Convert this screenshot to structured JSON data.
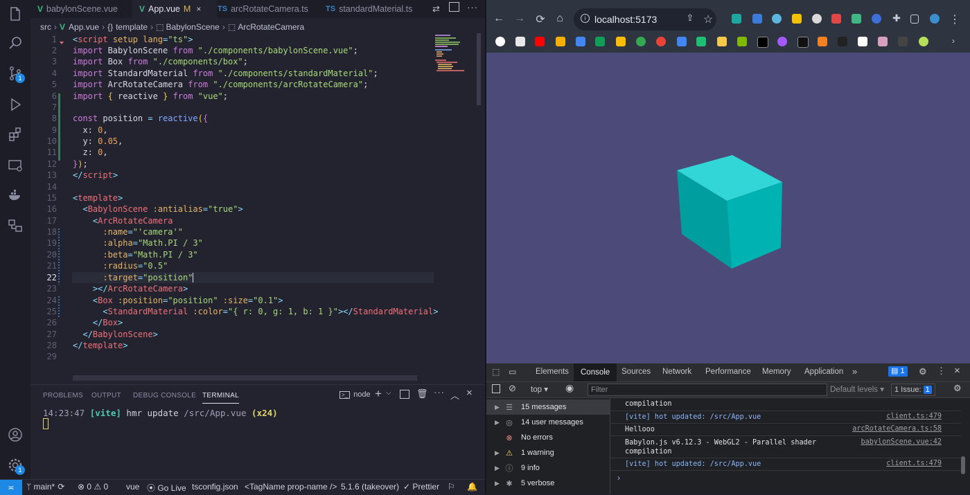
{
  "vscode": {
    "tabs": [
      {
        "label": "babylonScene.vue",
        "kind": "vue",
        "active": false
      },
      {
        "label": "App.vue",
        "kind": "vue",
        "active": true,
        "modified": "M",
        "close": "×"
      },
      {
        "label": "arcRotateCamera.ts",
        "kind": "ts",
        "active": false
      },
      {
        "label": "standardMaterial.ts",
        "kind": "ts",
        "active": false
      }
    ],
    "breadcrumb": {
      "folder": "src",
      "file": "App.vue",
      "section": "template",
      "node1": "BabylonScene",
      "node2": "ArcRotateCamera"
    },
    "activity_badges": {
      "scm": "1",
      "accounts": "1"
    },
    "line_numbers": [
      "1",
      "2",
      "3",
      "4",
      "5",
      "6",
      "7",
      "8",
      "9",
      "10",
      "11",
      "12",
      "13",
      "14",
      "15",
      "16",
      "17",
      "18",
      "19",
      "20",
      "21",
      "22",
      "23",
      "24",
      "25",
      "26",
      "27",
      "28",
      "29"
    ],
    "code": {
      "l1": {
        "open": "<",
        "tag": "script",
        "attr1": " setup",
        "attr2": " lang",
        "eq": "=",
        "val": "\"ts\"",
        "close": ">"
      },
      "l2": {
        "kw": "import",
        "name": " BabylonScene ",
        "from": "from",
        "path": " \"./components/babylonScene.vue\"",
        "end": ";"
      },
      "l3": {
        "kw": "import",
        "name": " Box ",
        "from": "from",
        "path": " \"./components/box\"",
        "end": ";"
      },
      "l4": {
        "kw": "import",
        "name": " StandardMaterial ",
        "from": "from",
        "path": " \"./components/standardMaterial\"",
        "end": ";"
      },
      "l5": {
        "kw": "import",
        "name": " ArcRotateCamera ",
        "from": "from",
        "path": " \"./components/arcRotateCamera\"",
        "end": ";"
      },
      "l6": {
        "kw": "import",
        "ob": " {",
        "name": " reactive ",
        "cb": "}",
        "from": " from",
        "path": " \"vue\"",
        "end": ";"
      },
      "l8": {
        "kw": "const",
        "name": " position ",
        "eq": "=",
        "fn": " reactive",
        "p": "(",
        "b": "{"
      },
      "l9": {
        "key": "  x:",
        "val": " 0",
        "end": ","
      },
      "l10": {
        "key": "  y:",
        "val": " 0.05",
        "end": ","
      },
      "l11": {
        "key": "  z:",
        "val": " 0",
        "end": ","
      },
      "l12": {
        "b": "}",
        "p": ")",
        "end": ";"
      },
      "l13": {
        "open": "</",
        "tag": "script",
        "close": ">"
      },
      "l15": {
        "open": "<",
        "tag": "template",
        "close": ">"
      },
      "l16": {
        "indent": "  ",
        "open": "<",
        "tag": "BabylonScene",
        "attr": " :antialias",
        "eq": "=",
        "val": "\"true\"",
        "close": ">"
      },
      "l17": {
        "indent": "    ",
        "open": "<",
        "tag": "ArcRotateCamera"
      },
      "l18": {
        "indent": "      ",
        "attr": ":name",
        "eq": "=",
        "val": "\"'camera'\""
      },
      "l19": {
        "indent": "      ",
        "attr": ":alpha",
        "eq": "=",
        "val": "\"Math.PI / 3\""
      },
      "l20": {
        "indent": "      ",
        "attr": ":beta",
        "eq": "=",
        "val": "\"Math.PI / 3\""
      },
      "l21": {
        "indent": "      ",
        "attr": ":radius",
        "eq": "=",
        "val": "\"0.5\""
      },
      "l22": {
        "indent": "      ",
        "attr": ":target",
        "eq": "=",
        "val": "\"position\""
      },
      "l23": {
        "indent": "    ",
        "open": "></",
        "tag": "ArcRotateCamera",
        "close": ">"
      },
      "l24": {
        "indent": "    ",
        "open": "<",
        "tag": "Box",
        "attr1": " :position",
        "eq1": "=",
        "val1": "\"position\"",
        "attr2": " :size",
        "eq2": "=",
        "val2": "\"0.1\"",
        "close": ">"
      },
      "l25": {
        "indent": "      ",
        "open": "<",
        "tag": "StandardMaterial",
        "attr": " :color",
        "eq": "=",
        "val": "\"{ r: 0, g: 1, b: 1 }\"",
        "mid": "></",
        "tag2": "StandardMaterial",
        "close": ">"
      },
      "l26": {
        "indent": "    ",
        "open": "</",
        "tag": "Box",
        "close": ">"
      },
      "l27": {
        "indent": "  ",
        "open": "</",
        "tag": "BabylonScene",
        "close": ">"
      },
      "l28": {
        "open": "</",
        "tag": "template",
        "close": ">"
      }
    },
    "panel": {
      "tabs": [
        "PROBLEMS",
        "OUTPUT",
        "DEBUG CONSOLE",
        "TERMINAL"
      ],
      "shell": "node",
      "terminal": {
        "time": "14:23:47 ",
        "vite": "[vite]",
        "msg": " hmr update ",
        "path": "/src/App.vue",
        "count": " (x24)"
      }
    },
    "status": {
      "branch": "main*",
      "errors": "0",
      "warnings": "0",
      "lang": "vue",
      "golive": "Go Live",
      "tsconfig": "tsconfig.json",
      "tagname": "<TagName prop-name />",
      "tsversion": "5.1.6 (takeover)",
      "prettier": "Prettier"
    }
  },
  "browser": {
    "url": "localhost:5173",
    "devtools": {
      "tabs": [
        "Elements",
        "Console",
        "Sources",
        "Network",
        "Performance",
        "Memory",
        "Application"
      ],
      "more": "»",
      "issues_badge": "1",
      "context": "top",
      "filter_placeholder": "Filter",
      "levels": "Default levels ▾",
      "issue_text": "1 Issue:",
      "issue_count": "1",
      "sidebar": [
        {
          "label": "15 messages",
          "icon": "list-icon"
        },
        {
          "label": "14 user messages",
          "icon": "user-icon"
        },
        {
          "label": "No errors",
          "icon": "error-icon"
        },
        {
          "label": "1 warning",
          "icon": "warning-icon"
        },
        {
          "label": "9 info",
          "icon": "info-icon"
        },
        {
          "label": "5 verbose",
          "icon": "bug-icon"
        }
      ],
      "logs": [
        {
          "text": "compilation",
          "source": ""
        },
        {
          "text": "[vite] hot updated: /src/App.vue",
          "source": "client.ts:479",
          "vite": true
        },
        {
          "text": "Hellooo",
          "source": "arcRotateCamera.ts:58"
        },
        {
          "text": "Babylon.js v6.12.3 - WebGL2 - Parallel shader\ncompilation",
          "source": "babylonScene.vue:42"
        },
        {
          "text": "[vite] hot updated: /src/App.vue",
          "source": "client.ts:479",
          "vite": true
        }
      ],
      "prompt": "›"
    },
    "scene": {
      "background": "#4b4a79",
      "cube_color": "#00b5b5"
    }
  }
}
